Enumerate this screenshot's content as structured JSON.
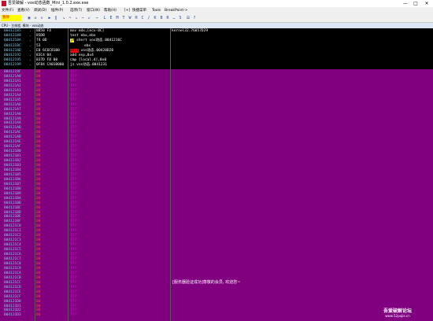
{
  "window": {
    "title": "吾爱破解 - vos动态函数_Mini_1.0.2.exe.exe"
  },
  "menu": [
    {
      "label": "文件(F)"
    },
    {
      "label": "查看(V)"
    },
    {
      "label": "调试(D)"
    },
    {
      "label": "插件(P)"
    },
    {
      "label": "选项(T)"
    },
    {
      "label": "窗口(W)"
    },
    {
      "label": "帮助(H)"
    },
    {
      "label": "[+]"
    },
    {
      "label": "快捷菜单"
    },
    {
      "label": "Tools"
    },
    {
      "label": "BreakPoint->"
    }
  ],
  "toolbar": {
    "status": "暂停"
  },
  "subtitle": "CPU - 主线程, 模块 - vos动态",
  "colors": {
    "bg": "#800080",
    "addr": "#87ceeb",
    "hex": "#ff4040",
    "asm": "#ff00ff",
    "text": "#ffffff"
  },
  "code_rows": [
    {
      "addr": "00412185",
      "dot": ".",
      "hex": "8B50 F4",
      "asm": "mov edx,[ecx-0C]",
      "cmt": "kernel32.76057D29",
      "hl": "none"
    },
    {
      "addr": "00412188",
      "dot": ".",
      "hex": "85DB",
      "asm": "test ebx,ebx",
      "cmt": "",
      "hl": "none"
    },
    {
      "addr": "0041218A",
      "dot": ".",
      "hex": "74 0D",
      "asm": "short vos动态.0041216C",
      "cmt": "",
      "hl": "yellow",
      "mark": "je"
    },
    {
      "addr": "0041218C",
      "dot": ".",
      "hex": "53",
      "asm": "ebx",
      "cmt": "",
      "hl": "none",
      "indent": true
    },
    {
      "addr": "0041218D",
      "dot": ".",
      "hex": "E8 6C6C8100",
      "asm": "vos动态.00420D20",
      "cmt": "",
      "hl": "red",
      "mark": "call"
    },
    {
      "addr": "00412192",
      "dot": ".",
      "hex": "83C4 04",
      "asm": "add esp,0x4",
      "cmt": "",
      "hl": "none"
    },
    {
      "addr": "00412195",
      "dot": ".",
      "hex": "837D F8 00",
      "asm": "cmp [local.4],0x0",
      "cmt": "",
      "hl": "none"
    },
    {
      "addr": "00412199",
      "dot": ".",
      "hex": "0F84 CA010000",
      "asm": "jz vos动态.0041231",
      "cmt": "",
      "hl": "none"
    }
  ],
  "filler_rows": [
    "0041219F",
    "004121A0",
    "004121A1",
    "004121A2",
    "004121A3",
    "004121A4",
    "004121A5",
    "004121A6",
    "004121A7",
    "004121A8",
    "004121A9",
    "004121AA",
    "004121AB",
    "004121AC",
    "004121AD",
    "004121AE",
    "004121AF",
    "004121B0",
    "004121B1",
    "004121B2",
    "004121B3",
    "004121B4",
    "004121B5",
    "004121B6",
    "004121B7",
    "004121B8",
    "004121B9",
    "004121BA",
    "004121BB",
    "004121BC",
    "004121BD",
    "004121BE",
    "004121BF",
    "004121C0",
    "004121C1",
    "004121C2",
    "004121C3",
    "004121C4",
    "004121C5",
    "004121C6",
    "004121C7",
    "004121C8",
    "004121C9",
    "004121CA",
    "004121CB",
    "004121CC",
    "004121CD",
    "004121CE",
    "004121CF",
    "004121D0",
    "004121D1",
    "004121D2",
    "004121D3"
  ],
  "status_message": "[服务器验证成功]尊敬的会员, 欢迎您~",
  "watermark": {
    "line1": "吾爱破解论坛",
    "line2": "www.52pojie.cn"
  }
}
